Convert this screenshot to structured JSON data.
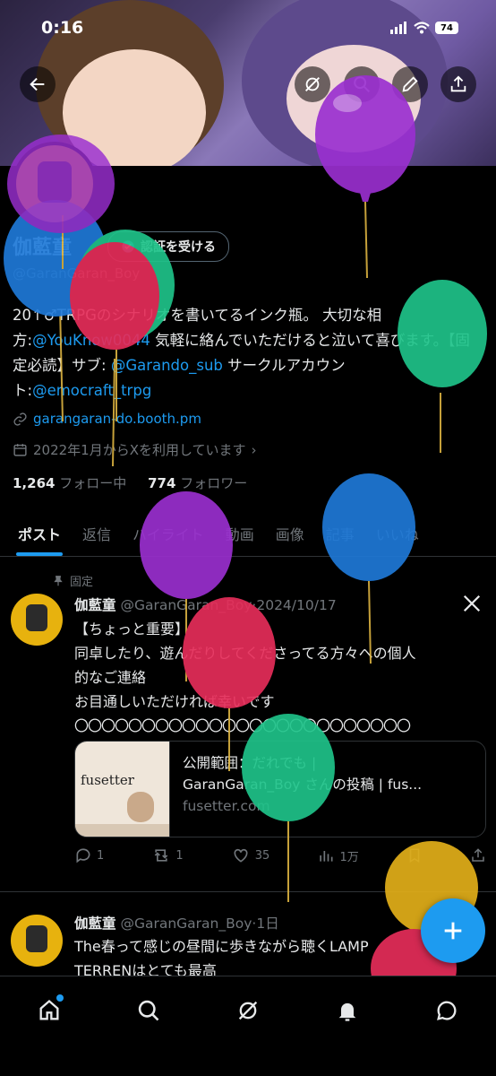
{
  "status": {
    "time": "0:16",
    "battery": "74"
  },
  "profile": {
    "name": "伽藍童",
    "handle": "@GaranGaran_Boy",
    "verify_label": "認証を受ける",
    "bio_parts": {
      "p1": "20↑♂TRPGのシナリオを書いてるインク瓶。 大切な相方:",
      "mention1": "@YouKnow0044",
      "p2": " 気軽に絡んでいただけると泣いて喜びます。【固定必読】サブ: ",
      "mention2": "@Garando_sub",
      "p3": " サークルアカウント:",
      "mention3": "@emocraft_trpg"
    },
    "website": "garangaran-do.booth.pm",
    "joined": "2022年1月からXを利用しています",
    "following_count": "1,264",
    "following_label": "フォロー中",
    "followers_count": "774",
    "followers_label": "フォロワー"
  },
  "tabs": [
    "ポスト",
    "返信",
    "ハイライト",
    "動画",
    "画像",
    "記事",
    "いいね"
  ],
  "pinned_label": "固定",
  "tweets": [
    {
      "name": "伽藍童",
      "handle": "@GaranGaran_Boy",
      "date": "2024/10/17",
      "lines": [
        "【ちょっと重要】",
        "同卓したり、遊んだりしてくださってる方々への個人",
        "的なご連絡",
        "お目通しいただければ幸いです",
        "〇〇〇〇〇〇〇〇〇〇〇〇〇〇〇〇〇〇〇〇〇〇〇〇〇"
      ],
      "card": {
        "thumb_text": "fusetter",
        "title1": "公開範囲：だれでも |",
        "title2": "GaranGaran_Boy さんの投稿 | fus...",
        "domain": "fusetter.com"
      },
      "replies": "1",
      "retweets": "1",
      "likes": "35",
      "views": "1万"
    },
    {
      "name": "伽藍童",
      "handle": "@GaranGaran_Boy",
      "date": "1日",
      "lines": [
        "The春って感じの昼間に歩きながら聴くLAMP",
        "TERRENはとても最高"
      ]
    }
  ],
  "colors": {
    "accent": "#1d9bf0",
    "background": "#000000",
    "avatar": "#e7b20e"
  },
  "icons": [
    "back-arrow-icon",
    "grok-icon",
    "search-icon",
    "edit-icon",
    "share-icon",
    "home-icon",
    "explore-icon",
    "notifications-icon",
    "messages-icon",
    "compose-icon",
    "x-logo-icon"
  ]
}
